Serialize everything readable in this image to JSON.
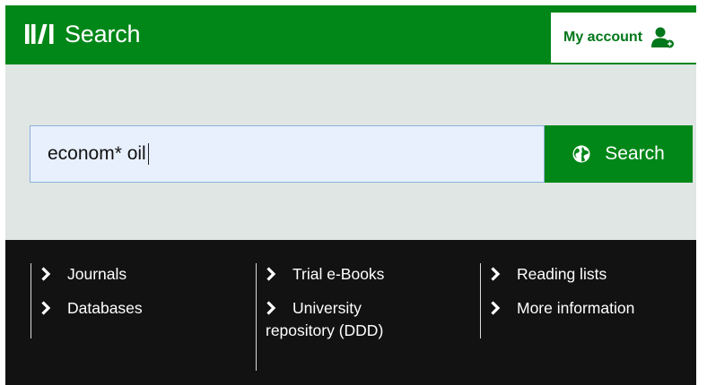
{
  "header": {
    "logo_text": "Search",
    "account_label": "My account",
    "brand_color": "#008718"
  },
  "search": {
    "query": "econom* oil",
    "button_label": "Search"
  },
  "links": {
    "journals": "Journals",
    "databases": "Databases",
    "trial_ebooks": "Trial e-Books",
    "university_repo_line1": "University",
    "university_repo_line2": "repository (DDD)",
    "reading_lists": "Reading lists",
    "more_information": "More information"
  }
}
